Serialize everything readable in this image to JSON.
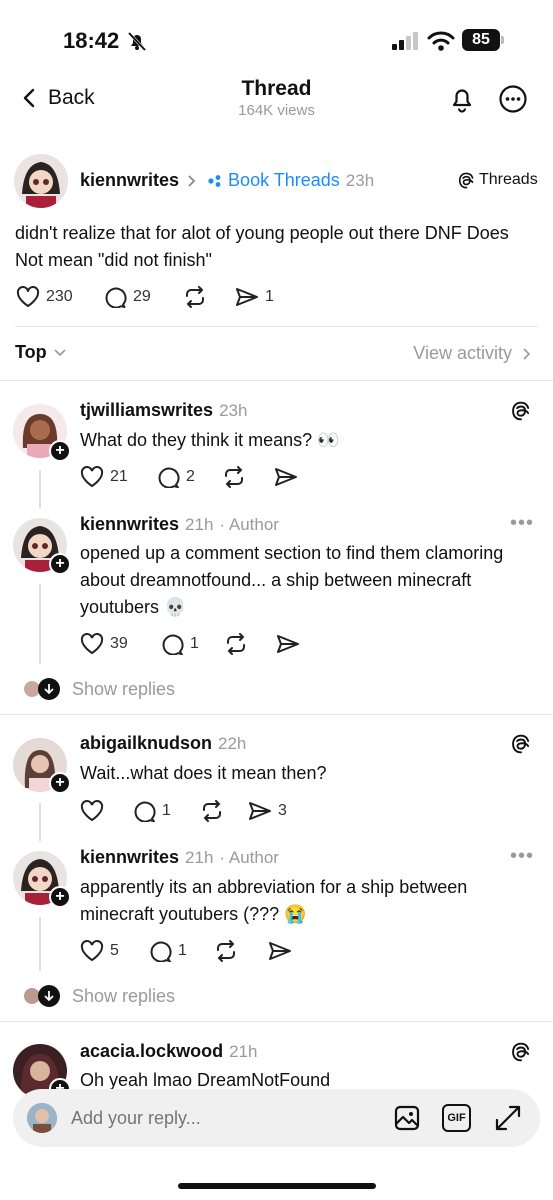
{
  "status_bar": {
    "time": "18:42",
    "battery": "85"
  },
  "nav": {
    "back_label": "Back",
    "title": "Thread",
    "views": "164K views"
  },
  "post": {
    "username": "kiennwrites",
    "community": "Book Threads",
    "time": "23h",
    "badge": "Threads",
    "text": "didn't realize that for alot of young people out there DNF Does Not mean \"did not finish\"",
    "likes": "230",
    "comments": "29",
    "shares": "1"
  },
  "sort": {
    "label": "Top",
    "view_activity": "View activity"
  },
  "replies": [
    {
      "username": "tjwilliamswrites",
      "time": "23h",
      "text": "What do they think it means? 👀",
      "likes": "21",
      "comments": "2"
    },
    {
      "username": "kiennwrites",
      "time": "21h",
      "author_tag": "· Author",
      "text": "opened up a comment section to find them clamoring about dreamnotfound... a ship between minecraft youtubers 💀",
      "likes": "39",
      "comments": "1"
    },
    {
      "username": "abigailknudson",
      "time": "22h",
      "text": "Wait...what does it mean then?",
      "comments": "1",
      "shares": "3"
    },
    {
      "username": "kiennwrites",
      "time": "21h",
      "author_tag": "· Author",
      "text": "apparently its an abbreviation for a ship between minecraft youtubers (??? 😭",
      "likes": "5",
      "comments": "1"
    },
    {
      "username": "acacia.lockwood",
      "time": "21h",
      "text": "Oh yeah lmao DreamNotFound"
    }
  ],
  "show_replies_label": "Show replies",
  "reply_bar": {
    "placeholder": "Add your reply...",
    "gif_label": "GIF"
  },
  "colors": {
    "accent": "#1a8cff",
    "text": "#111111",
    "muted": "#9a9a9a"
  }
}
